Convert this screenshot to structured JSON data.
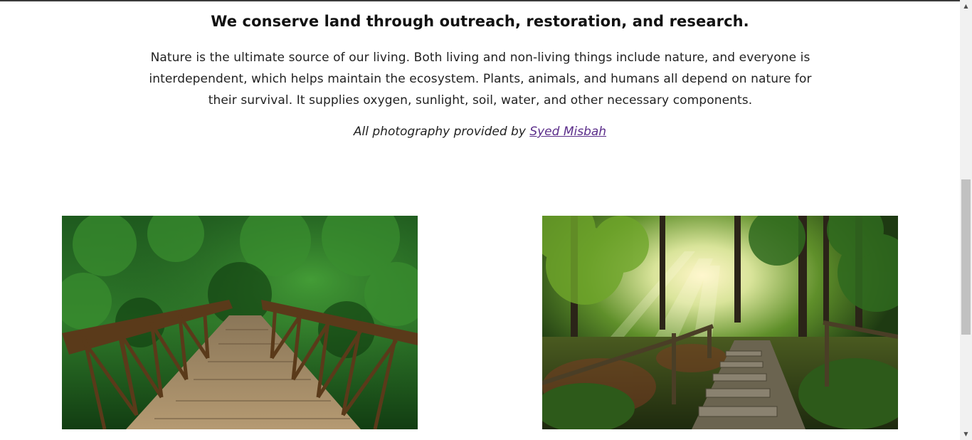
{
  "intro": {
    "heading": "We conserve land through outreach, restoration, and research.",
    "paragraph": "Nature is the ultimate source of our living. Both living and non-living things include nature, and everyone is interdependent, which helps maintain the ecosystem. Plants, animals, and humans all depend on nature for their survival. It supplies oxygen, sunlight, soil, water, and other necessary components.",
    "credit_prefix": "All photography provided by",
    "credit_link": "Syed Misbah"
  },
  "gallery": {
    "photos": [
      {
        "subject": "wooden footbridge in forest"
      },
      {
        "subject": "sunlit forest path with stairs"
      }
    ]
  },
  "colors": {
    "link": "#5b2d8a",
    "text": "#222222"
  },
  "scrollbar": {
    "up_icon": "triangle-up-icon",
    "down_icon": "triangle-down-icon"
  }
}
